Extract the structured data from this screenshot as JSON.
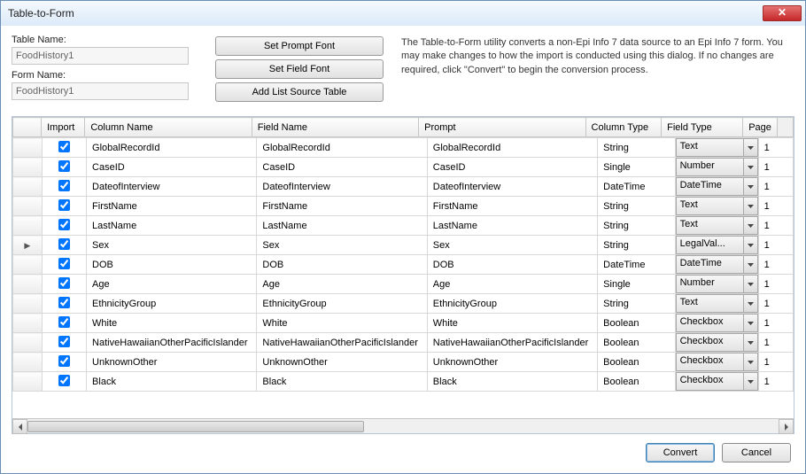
{
  "window": {
    "title": "Table-to-Form"
  },
  "labels": {
    "table_name": "Table Name:",
    "form_name": "Form Name:"
  },
  "fields": {
    "table_name": "FoodHistory1",
    "form_name": "FoodHistory1"
  },
  "buttons": {
    "set_prompt_font": "Set Prompt Font",
    "set_field_font": "Set Field Font",
    "add_list_source": "Add List Source Table",
    "convert": "Convert",
    "cancel": "Cancel"
  },
  "description": "The Table-to-Form utility converts a non-Epi Info 7 data source to an Epi Info 7 form. You may make changes to how the import is conducted using this dialog. If no changes are required, click \"Convert\" to begin the conversion process.",
  "columns": {
    "import": "Import",
    "column_name": "Column Name",
    "field_name": "Field Name",
    "prompt": "Prompt",
    "column_type": "Column Type",
    "field_type": "Field Type",
    "page": "Page"
  },
  "rows": [
    {
      "import": true,
      "column_name": "GlobalRecordId",
      "field_name": "GlobalRecordId",
      "prompt": "GlobalRecordId",
      "column_type": "String",
      "field_type": "Text",
      "page": "1",
      "marker": ""
    },
    {
      "import": true,
      "column_name": "CaseID",
      "field_name": "CaseID",
      "prompt": "CaseID",
      "column_type": "Single",
      "field_type": "Number",
      "page": "1",
      "marker": ""
    },
    {
      "import": true,
      "column_name": "DateofInterview",
      "field_name": "DateofInterview",
      "prompt": "DateofInterview",
      "column_type": "DateTime",
      "field_type": "DateTime",
      "page": "1",
      "marker": ""
    },
    {
      "import": true,
      "column_name": "FirstName",
      "field_name": "FirstName",
      "prompt": "FirstName",
      "column_type": "String",
      "field_type": "Text",
      "page": "1",
      "marker": ""
    },
    {
      "import": true,
      "column_name": "LastName",
      "field_name": "LastName",
      "prompt": "LastName",
      "column_type": "String",
      "field_type": "Text",
      "page": "1",
      "marker": ""
    },
    {
      "import": true,
      "column_name": "Sex",
      "field_name": "Sex",
      "prompt": "Sex",
      "column_type": "String",
      "field_type": "LegalVal...",
      "page": "1",
      "marker": "▶"
    },
    {
      "import": true,
      "column_name": "DOB",
      "field_name": "DOB",
      "prompt": "DOB",
      "column_type": "DateTime",
      "field_type": "DateTime",
      "page": "1",
      "marker": ""
    },
    {
      "import": true,
      "column_name": "Age",
      "field_name": "Age",
      "prompt": "Age",
      "column_type": "Single",
      "field_type": "Number",
      "page": "1",
      "marker": ""
    },
    {
      "import": true,
      "column_name": "EthnicityGroup",
      "field_name": "EthnicityGroup",
      "prompt": "EthnicityGroup",
      "column_type": "String",
      "field_type": "Text",
      "page": "1",
      "marker": ""
    },
    {
      "import": true,
      "column_name": "White",
      "field_name": "White",
      "prompt": "White",
      "column_type": "Boolean",
      "field_type": "Checkbox",
      "page": "1",
      "marker": ""
    },
    {
      "import": true,
      "column_name": "NativeHawaiianOtherPacificIslander",
      "field_name": "NativeHawaiianOtherPacificIslander",
      "prompt": "NativeHawaiianOtherPacificIslander",
      "column_type": "Boolean",
      "field_type": "Checkbox",
      "page": "1",
      "marker": ""
    },
    {
      "import": true,
      "column_name": "UnknownOther",
      "field_name": "UnknownOther",
      "prompt": "UnknownOther",
      "column_type": "Boolean",
      "field_type": "Checkbox",
      "page": "1",
      "marker": ""
    },
    {
      "import": true,
      "column_name": "Black",
      "field_name": "Black",
      "prompt": "Black",
      "column_type": "Boolean",
      "field_type": "Checkbox",
      "page": "1",
      "marker": ""
    }
  ]
}
